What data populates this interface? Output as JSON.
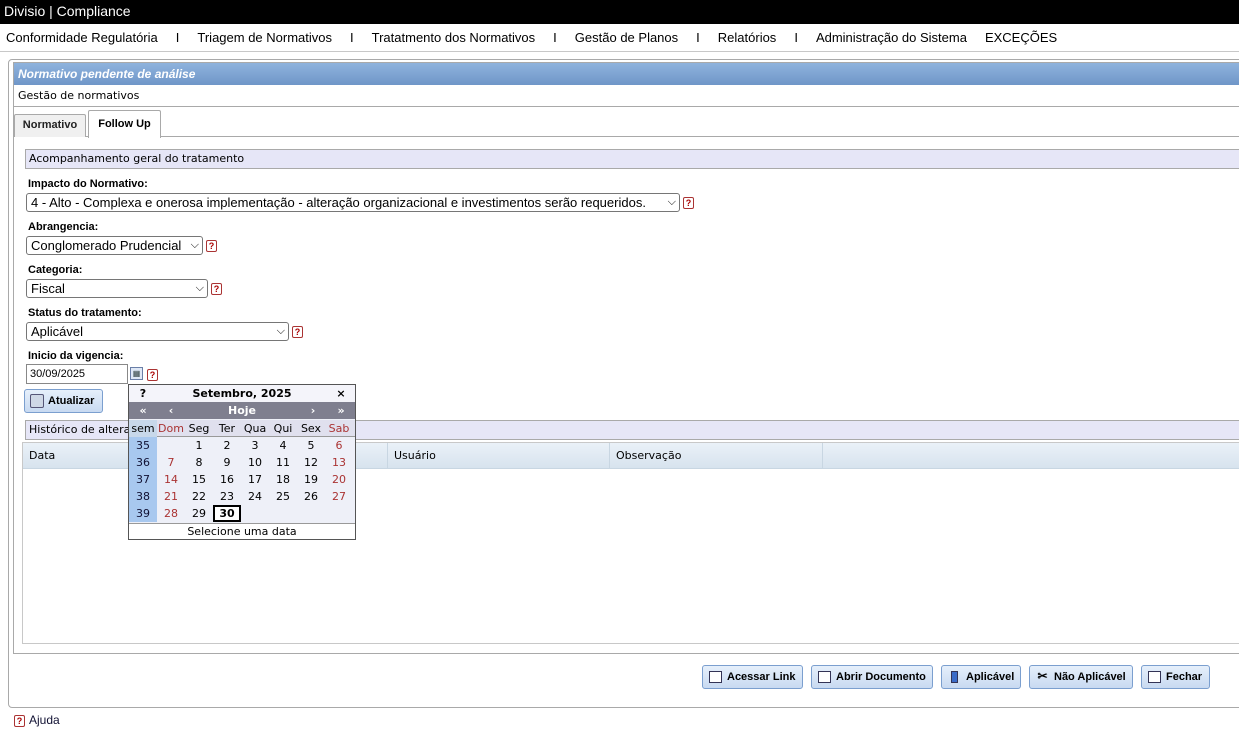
{
  "app": {
    "title": "Divisio | Compliance"
  },
  "menu": {
    "items": [
      "Conformidade Regulatória",
      "Triagem de Normativos",
      "Tratatmento dos Normativos",
      "Gestão de Planos",
      "Relatórios",
      "Administração do Sistema",
      "EXCEÇÕES"
    ],
    "separator": "I"
  },
  "page": {
    "header": "Normativo pendente de análise",
    "subheader": "Gestão de normativos"
  },
  "tabs": [
    {
      "label": "Normativo",
      "active": false
    },
    {
      "label": "Follow Up",
      "active": true
    }
  ],
  "section": {
    "title": "Acompanhamento geral do tratamento"
  },
  "form": {
    "impacto": {
      "label": "Impacto do Normativo:",
      "value": "4 - Alto - Complexa e onerosa implementação - alteração organizacional e investimentos serão requeridos."
    },
    "abrangencia": {
      "label": "Abrangencia:",
      "value": "Conglomerado Prudencial"
    },
    "categoria": {
      "label": "Categoria:",
      "value": "Fiscal"
    },
    "status": {
      "label": "Status do tratamento:",
      "value": "Aplicável"
    },
    "vigencia": {
      "label": "Inicio da vigencia:",
      "value": "30/09/2025"
    },
    "help_glyph": "?",
    "atualizar_label": "Atualizar"
  },
  "history": {
    "title": "Histórico de altera",
    "columns": [
      "Data",
      "Usuário",
      "Observação"
    ]
  },
  "calendar": {
    "help": "?",
    "month_title": "Setembro, 2025",
    "close": "×",
    "nav": {
      "prev_year": "«",
      "prev_month": "‹",
      "today": "Hoje",
      "next_month": "›",
      "next_year": "»"
    },
    "week_header": "sem",
    "days": [
      "Dom",
      "Seg",
      "Ter",
      "Qua",
      "Qui",
      "Sex",
      "Sab"
    ],
    "weeks": [
      {
        "wk": "35",
        "days": [
          "",
          "1",
          "2",
          "3",
          "4",
          "5",
          "6"
        ]
      },
      {
        "wk": "36",
        "days": [
          "7",
          "8",
          "9",
          "10",
          "11",
          "12",
          "13"
        ]
      },
      {
        "wk": "37",
        "days": [
          "14",
          "15",
          "16",
          "17",
          "18",
          "19",
          "20"
        ]
      },
      {
        "wk": "38",
        "days": [
          "21",
          "22",
          "23",
          "24",
          "25",
          "26",
          "27"
        ]
      },
      {
        "wk": "39",
        "days": [
          "28",
          "29",
          "30",
          "",
          "",
          "",
          ""
        ]
      }
    ],
    "selected_day": "30",
    "footer": "Selecione uma data"
  },
  "buttons": {
    "acessar_link": "Acessar Link",
    "abrir_documento": "Abrir Documento",
    "aplicavel": "Aplicável",
    "nao_aplicavel": "Não Aplicável",
    "fechar": "Fechar"
  },
  "footer": {
    "ajuda": "Ajuda"
  }
}
